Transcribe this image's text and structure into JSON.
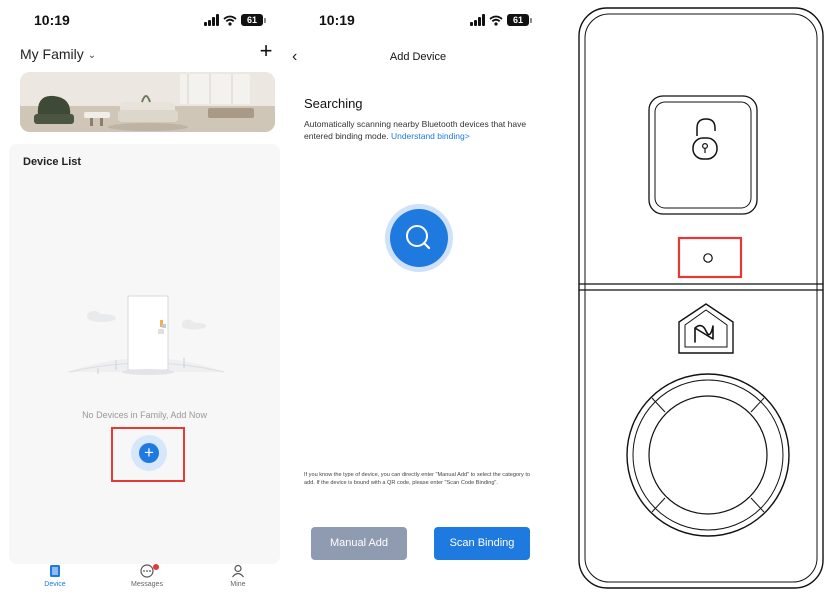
{
  "device_list_screen": {
    "status": {
      "time": "10:19",
      "battery": "61"
    },
    "family_selector": "My Family",
    "section_title": "Device List",
    "empty_message": "No Devices in Family, Add Now",
    "tabs": [
      {
        "label": "Device",
        "active": true,
        "icon": "device-icon"
      },
      {
        "label": "Messages",
        "active": false,
        "icon": "messages-icon",
        "has_badge": true
      },
      {
        "label": "Mine",
        "active": false,
        "icon": "person-icon"
      }
    ],
    "highlight_color": "#e53935",
    "accent_color": "#1f7ae0"
  },
  "add_device_screen": {
    "status": {
      "time": "10:19",
      "battery": "61"
    },
    "title": "Add Device",
    "heading": "Searching",
    "description": "Automatically scanning nearby Bluetooth devices that have entered binding mode.",
    "binding_link": "Understand binding>",
    "hint": "If you know the type of device, you can directly enter \"Manual Add\" to select the category to add. If the device is bound with a QR code, please enter \"Scan Code Binding\".",
    "manual_add_label": "Manual Add",
    "scan_binding_label": "Scan Binding"
  },
  "lock_illustration": {
    "icons": [
      "padlock-open-icon",
      "reset-hole",
      "house-logo-icon",
      "round-knob"
    ]
  }
}
